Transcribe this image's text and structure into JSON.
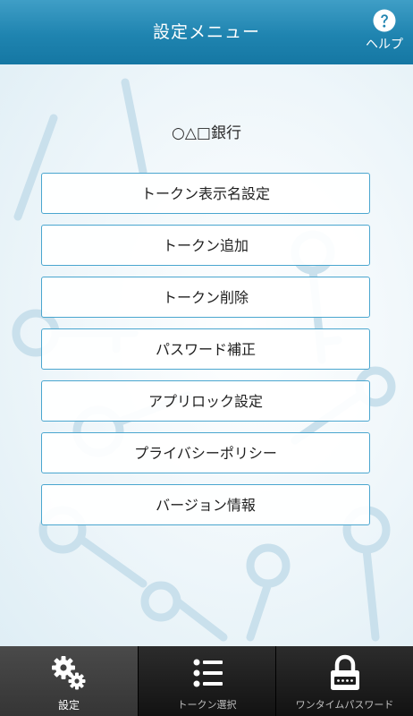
{
  "header": {
    "title": "設定メニュー",
    "help_label": "ヘルプ"
  },
  "main": {
    "bank_name": "○△□銀行",
    "menu": [
      {
        "label": "トークン表示名設定"
      },
      {
        "label": "トークン追加"
      },
      {
        "label": "トークン削除"
      },
      {
        "label": "パスワード補正"
      },
      {
        "label": "アプリロック設定"
      },
      {
        "label": "プライバシーポリシー"
      },
      {
        "label": "バージョン情報"
      }
    ]
  },
  "tabbar": {
    "tabs": [
      {
        "label": "設定",
        "icon": "gears-icon",
        "active": true
      },
      {
        "label": "トークン選択",
        "icon": "list-icon",
        "active": false
      },
      {
        "label": "ワンタイムパスワード",
        "icon": "padlock-icon",
        "active": false
      }
    ]
  },
  "colors": {
    "header": "#1f84b0",
    "button_border": "#4aa6cf",
    "tabbar": "#1b1b1b"
  }
}
